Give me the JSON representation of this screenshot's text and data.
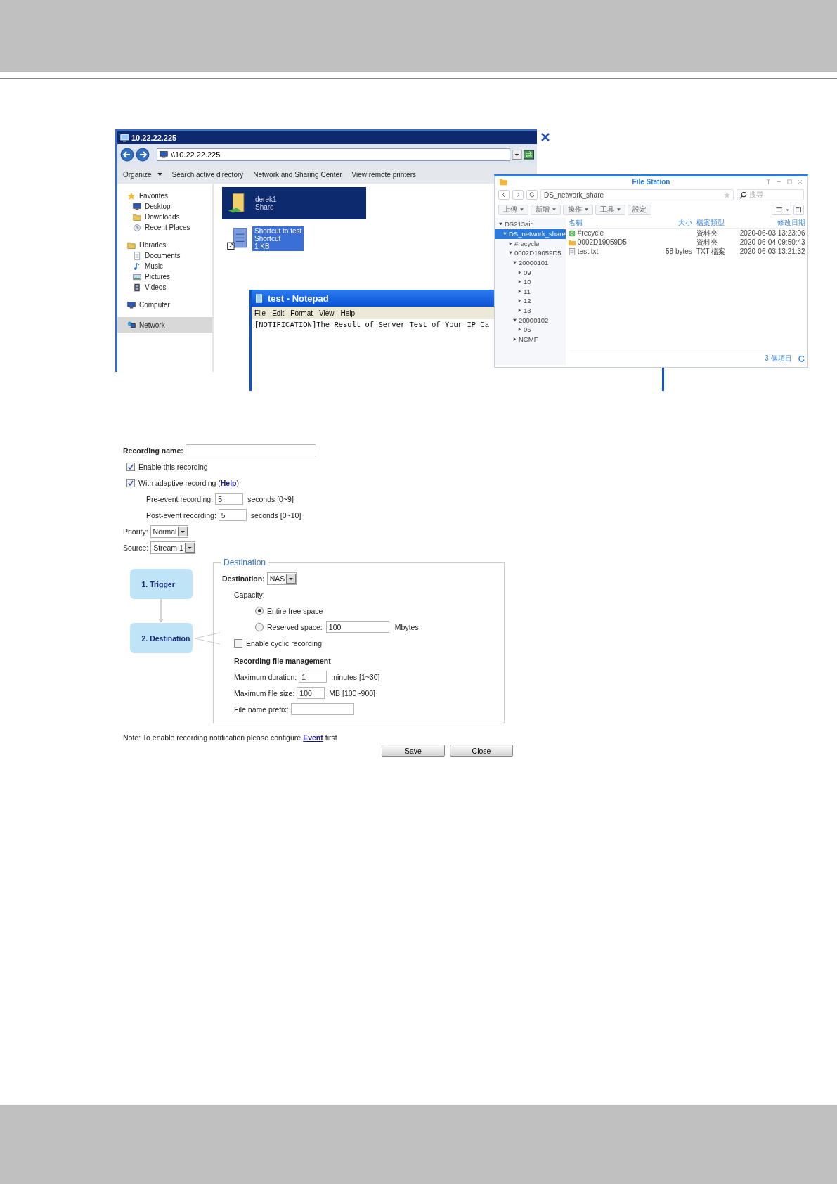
{
  "explorer": {
    "title": "10.22.22.225",
    "address": "\\\\10.22.22.225",
    "toolbar": [
      {
        "label": "Organize",
        "dropdown": true
      },
      {
        "label": "Search active directory",
        "dropdown": false
      },
      {
        "label": "Network and Sharing Center",
        "dropdown": false
      },
      {
        "label": "View remote printers",
        "dropdown": false
      }
    ],
    "nav": [
      {
        "label": "Favorites",
        "kind": "star",
        "selected": false,
        "children": [
          {
            "label": "Desktop",
            "kind": "monitor",
            "selected": false
          },
          {
            "label": "Downloads",
            "kind": "folder",
            "selected": false
          },
          {
            "label": "Recent Places",
            "kind": "clock",
            "selected": false
          }
        ]
      },
      {
        "label": "Libraries",
        "kind": "folder",
        "selected": false,
        "children": [
          {
            "label": "Documents",
            "kind": "document",
            "selected": false
          },
          {
            "label": "Music",
            "kind": "note",
            "selected": false
          },
          {
            "label": "Pictures",
            "kind": "picture",
            "selected": false
          },
          {
            "label": "Videos",
            "kind": "film",
            "selected": false
          }
        ]
      },
      {
        "label": "Computer",
        "kind": "monitor",
        "selected": false
      },
      {
        "label": "Network",
        "kind": "network",
        "selected": true
      }
    ],
    "items": [
      {
        "kind": "share",
        "name": "derek1",
        "detail": "Share",
        "selected": true
      },
      {
        "kind": "shortcut",
        "name": "Shortcut to test",
        "detail": "Shortcut",
        "size": "1 KB",
        "selected": true
      }
    ]
  },
  "notepad": {
    "title": "test - Notepad",
    "menu": [
      "File",
      "Edit",
      "Format",
      "View",
      "Help"
    ],
    "text": "[NOTIFICATION]The Result of Server Test of Your IP Ca"
  },
  "file_station": {
    "title": "File Station",
    "path": "DS_network_share",
    "search_placeholder": "搜尋",
    "toolbar": [
      {
        "label": "上傳",
        "dropdown": true
      },
      {
        "label": "新增",
        "dropdown": true
      },
      {
        "label": "操作",
        "dropdown": true
      },
      {
        "label": "工具",
        "dropdown": true
      },
      {
        "label": "設定",
        "dropdown": false
      }
    ],
    "tree": [
      {
        "label": "DS213air",
        "expanded": true,
        "selected": false,
        "children": [
          {
            "label": "DS_network_share",
            "expanded": true,
            "selected": true,
            "children": [
              {
                "label": "#recycle",
                "expanded": false,
                "selected": false
              },
              {
                "label": "0002D19059D5",
                "expanded": true,
                "selected": false,
                "children": [
                  {
                    "label": "20000101",
                    "expanded": true,
                    "selected": false,
                    "children": [
                      {
                        "label": "09",
                        "expanded": false,
                        "selected": false
                      },
                      {
                        "label": "10",
                        "expanded": false,
                        "selected": false
                      },
                      {
                        "label": "11",
                        "expanded": false,
                        "selected": false
                      },
                      {
                        "label": "12",
                        "expanded": false,
                        "selected": false
                      },
                      {
                        "label": "13",
                        "expanded": false,
                        "selected": false
                      }
                    ]
                  },
                  {
                    "label": "20000102",
                    "expanded": true,
                    "selected": false,
                    "children": [
                      {
                        "label": "05",
                        "expanded": false,
                        "selected": false
                      }
                    ]
                  },
                  {
                    "label": "NCMF",
                    "expanded": false,
                    "selected": false
                  }
                ]
              }
            ]
          }
        ]
      }
    ],
    "columns": [
      "名稱",
      "大小",
      "檔案類型",
      "修改日期"
    ],
    "rows": [
      {
        "kind": "recycle",
        "name": "#recycle",
        "type": "資料夾",
        "modified": "2020-06-03 13:23:06"
      },
      {
        "kind": "folder",
        "name": "0002D19059D5",
        "type": "資料夾",
        "modified": "2020-06-04 09:50:43"
      },
      {
        "kind": "file",
        "name": "test.txt",
        "size": "58 bytes",
        "type": "TXT 檔案",
        "modified": "2020-06-03 13:21:32"
      }
    ],
    "footer": "3 個項目"
  },
  "form": {
    "recording_name": {
      "label": "Recording name:"
    },
    "options": [
      {
        "label": "Enable this recording",
        "checked": true
      },
      {
        "label": "With adaptive recording (",
        "link": "Help",
        "suffix": ")",
        "checked": true
      }
    ],
    "event_fields": [
      {
        "label": "Pre-event recording:",
        "value": "5",
        "hint": "seconds [0~9]"
      },
      {
        "label": "Post-event recording:",
        "value": "5",
        "hint": "seconds [0~10]"
      }
    ],
    "selects": [
      {
        "label": "Priority:",
        "value": "Normal"
      },
      {
        "label": "Source:",
        "value": "Stream 1"
      }
    ],
    "steps": [
      {
        "label": "1. Trigger"
      },
      {
        "label": "2. Destination"
      }
    ],
    "destination": {
      "legend": "Destination",
      "label": "Destination:",
      "value": "NAS",
      "capacity_label": "Capacity:",
      "capacity_options": [
        {
          "label": "Entire free space",
          "selected": true
        },
        {
          "label": "Reserved space:",
          "selected": false,
          "value": "100",
          "unit": "Mbytes"
        }
      ],
      "cyclic": {
        "label": "Enable cyclic recording",
        "checked": false
      },
      "management_title": "Recording file management",
      "fields": [
        {
          "label": "Maximum duration:",
          "value": "1",
          "hint": "minutes [1~30]"
        },
        {
          "label": "Maximum file size:",
          "value": "100",
          "hint": "MB [100~900]"
        },
        {
          "label": "File name prefix:"
        }
      ]
    },
    "note": {
      "text": "Note: To enable recording notification please configure",
      "link": "Event",
      "suffix": "first"
    },
    "buttons": [
      "Save",
      "Close"
    ]
  }
}
